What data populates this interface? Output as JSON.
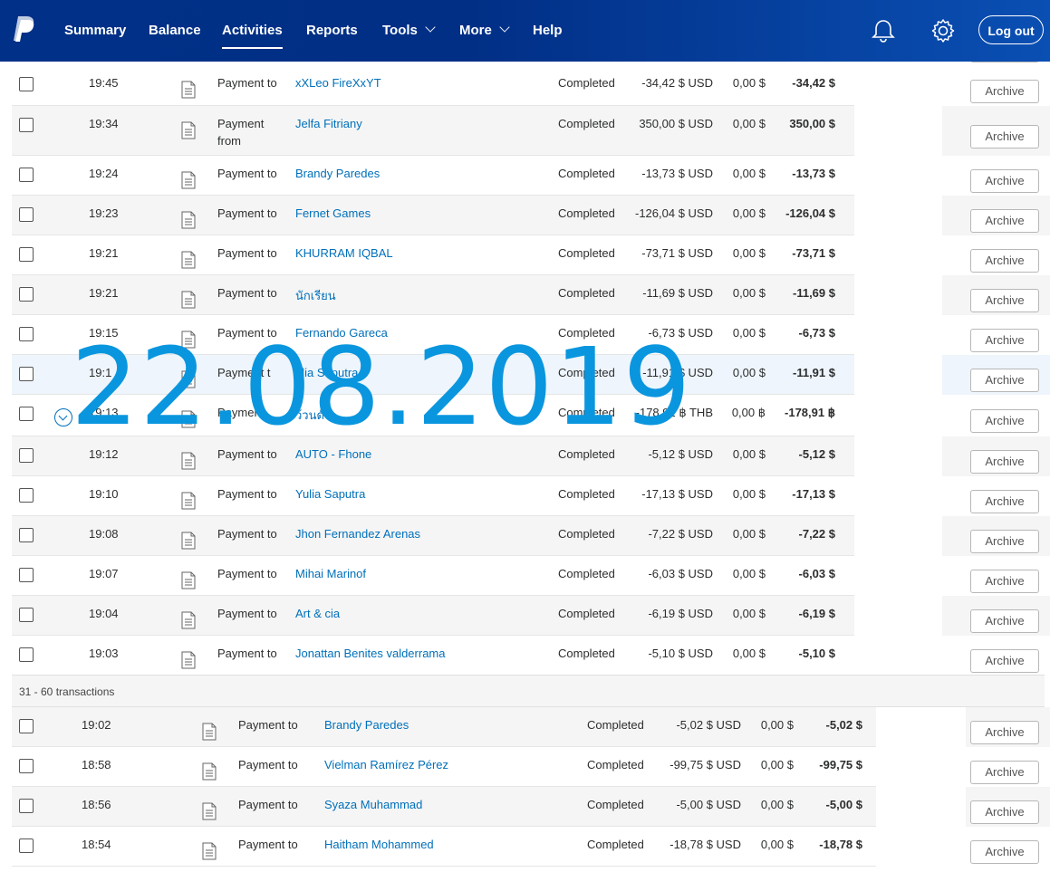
{
  "header": {
    "nav": [
      {
        "label": "Summary",
        "caret": false,
        "active": false
      },
      {
        "label": "Balance",
        "caret": false,
        "active": false
      },
      {
        "label": "Activities",
        "caret": false,
        "active": true
      },
      {
        "label": "Reports",
        "caret": false,
        "active": false
      },
      {
        "label": "Tools",
        "caret": true,
        "active": false
      },
      {
        "label": "More",
        "caret": true,
        "active": false
      },
      {
        "label": "Help",
        "caret": false,
        "active": false
      }
    ],
    "logout_label": "Log out",
    "icons": [
      "paypal-logo",
      "bell-icon",
      "gear-icon"
    ],
    "brand_color": "#003087"
  },
  "watermark": "22.08.2019",
  "transactions_top": [
    {
      "time": "19:45",
      "type": "Payment to",
      "name": "xXLeo FireXxYT",
      "status": "Completed",
      "gross": "-34,42 $ USD",
      "fee": "0,00 $",
      "net": "-34,42 $",
      "action": "Archive"
    },
    {
      "time": "19:34",
      "type": "Payment from",
      "name": "Jelfa Fitriany",
      "status": "Completed",
      "gross": "350,00 $ USD",
      "fee": "0,00 $",
      "net": "350,00 $",
      "action": "Archive"
    },
    {
      "time": "19:24",
      "type": "Payment to",
      "name": "Brandy Paredes",
      "status": "Completed",
      "gross": "-13,73 $ USD",
      "fee": "0,00 $",
      "net": "-13,73 $",
      "action": "Archive"
    },
    {
      "time": "19:23",
      "type": "Payment to",
      "name": "Fernet Games",
      "status": "Completed",
      "gross": "-126,04 $ USD",
      "fee": "0,00 $",
      "net": "-126,04 $",
      "action": "Archive"
    },
    {
      "time": "19:21",
      "type": "Payment to",
      "name": "KHURRAM IQBAL",
      "status": "Completed",
      "gross": "-73,71 $ USD",
      "fee": "0,00 $",
      "net": "-73,71 $",
      "action": "Archive"
    },
    {
      "time": "19:21",
      "type": "Payment to",
      "name": "นักเรียน",
      "status": "Completed",
      "gross": "-11,69 $ USD",
      "fee": "0,00 $",
      "net": "-11,69 $",
      "action": "Archive"
    },
    {
      "time": "19:15",
      "type": "Payment to",
      "name": "Fernando Gareca",
      "status": "Completed",
      "gross": "-6,73 $ USD",
      "fee": "0,00 $",
      "net": "-6,73 $",
      "action": "Archive"
    },
    {
      "time": "19:1",
      "type": "Payment t",
      "name": "ulia Saputra",
      "status": "Completed",
      "gross": "-11,91 $ USD",
      "fee": "0,00 $",
      "net": "-11,91 $",
      "action": "Archive"
    },
    {
      "time": "19:13",
      "type": "Payment",
      "name": "ว้วนดัว",
      "status": "Completed",
      "gross": "-178,91 ฿ THB",
      "fee": "0,00 ฿",
      "net": "-178,91 ฿",
      "action": "Archive"
    },
    {
      "time": "19:12",
      "type": "Payment to",
      "name": "AUTO - Fhone",
      "status": "Completed",
      "gross": "-5,12 $ USD",
      "fee": "0,00 $",
      "net": "-5,12 $",
      "action": "Archive"
    },
    {
      "time": "19:10",
      "type": "Payment to",
      "name": "Yulia Saputra",
      "status": "Completed",
      "gross": "-17,13 $ USD",
      "fee": "0,00 $",
      "net": "-17,13 $",
      "action": "Archive"
    },
    {
      "time": "19:08",
      "type": "Payment to",
      "name": "Jhon Fernandez Arenas",
      "status": "Completed",
      "gross": "-7,22 $ USD",
      "fee": "0,00 $",
      "net": "-7,22 $",
      "action": "Archive"
    },
    {
      "time": "19:07",
      "type": "Payment to",
      "name": "Mihai Marinof",
      "status": "Completed",
      "gross": "-6,03 $ USD",
      "fee": "0,00 $",
      "net": "-6,03 $",
      "action": "Archive"
    },
    {
      "time": "19:04",
      "type": "Payment to",
      "name": "Art & cia",
      "status": "Completed",
      "gross": "-6,19 $ USD",
      "fee": "0,00 $",
      "net": "-6,19 $",
      "action": "Archive"
    },
    {
      "time": "19:03",
      "type": "Payment to",
      "name": "Jonattan Benites valderrama",
      "status": "Completed",
      "gross": "-5,10 $ USD",
      "fee": "0,00 $",
      "net": "-5,10 $",
      "action": "Archive"
    }
  ],
  "section_label": "31 - 60 transactions",
  "transactions_bottom": [
    {
      "time": "19:02",
      "type": "Payment to",
      "name": "Brandy Paredes",
      "status": "Completed",
      "gross": "-5,02 $ USD",
      "fee": "0,00 $",
      "net": "-5,02 $",
      "action": "Archive"
    },
    {
      "time": "18:58",
      "type": "Payment to",
      "name": "Vielman Ramírez Pérez",
      "status": "Completed",
      "gross": "-99,75 $ USD",
      "fee": "0,00 $",
      "net": "-99,75 $",
      "action": "Archive"
    },
    {
      "time": "18:56",
      "type": "Payment to",
      "name": "Syaza Muhammad",
      "status": "Completed",
      "gross": "-5,00 $ USD",
      "fee": "0,00 $",
      "net": "-5,00 $",
      "action": "Archive"
    },
    {
      "time": "18:54",
      "type": "Payment to",
      "name": "Haitham Mohammed",
      "status": "Completed",
      "gross": "-18,78 $ USD",
      "fee": "0,00 $",
      "net": "-18,78 $",
      "action": "Archive"
    }
  ]
}
